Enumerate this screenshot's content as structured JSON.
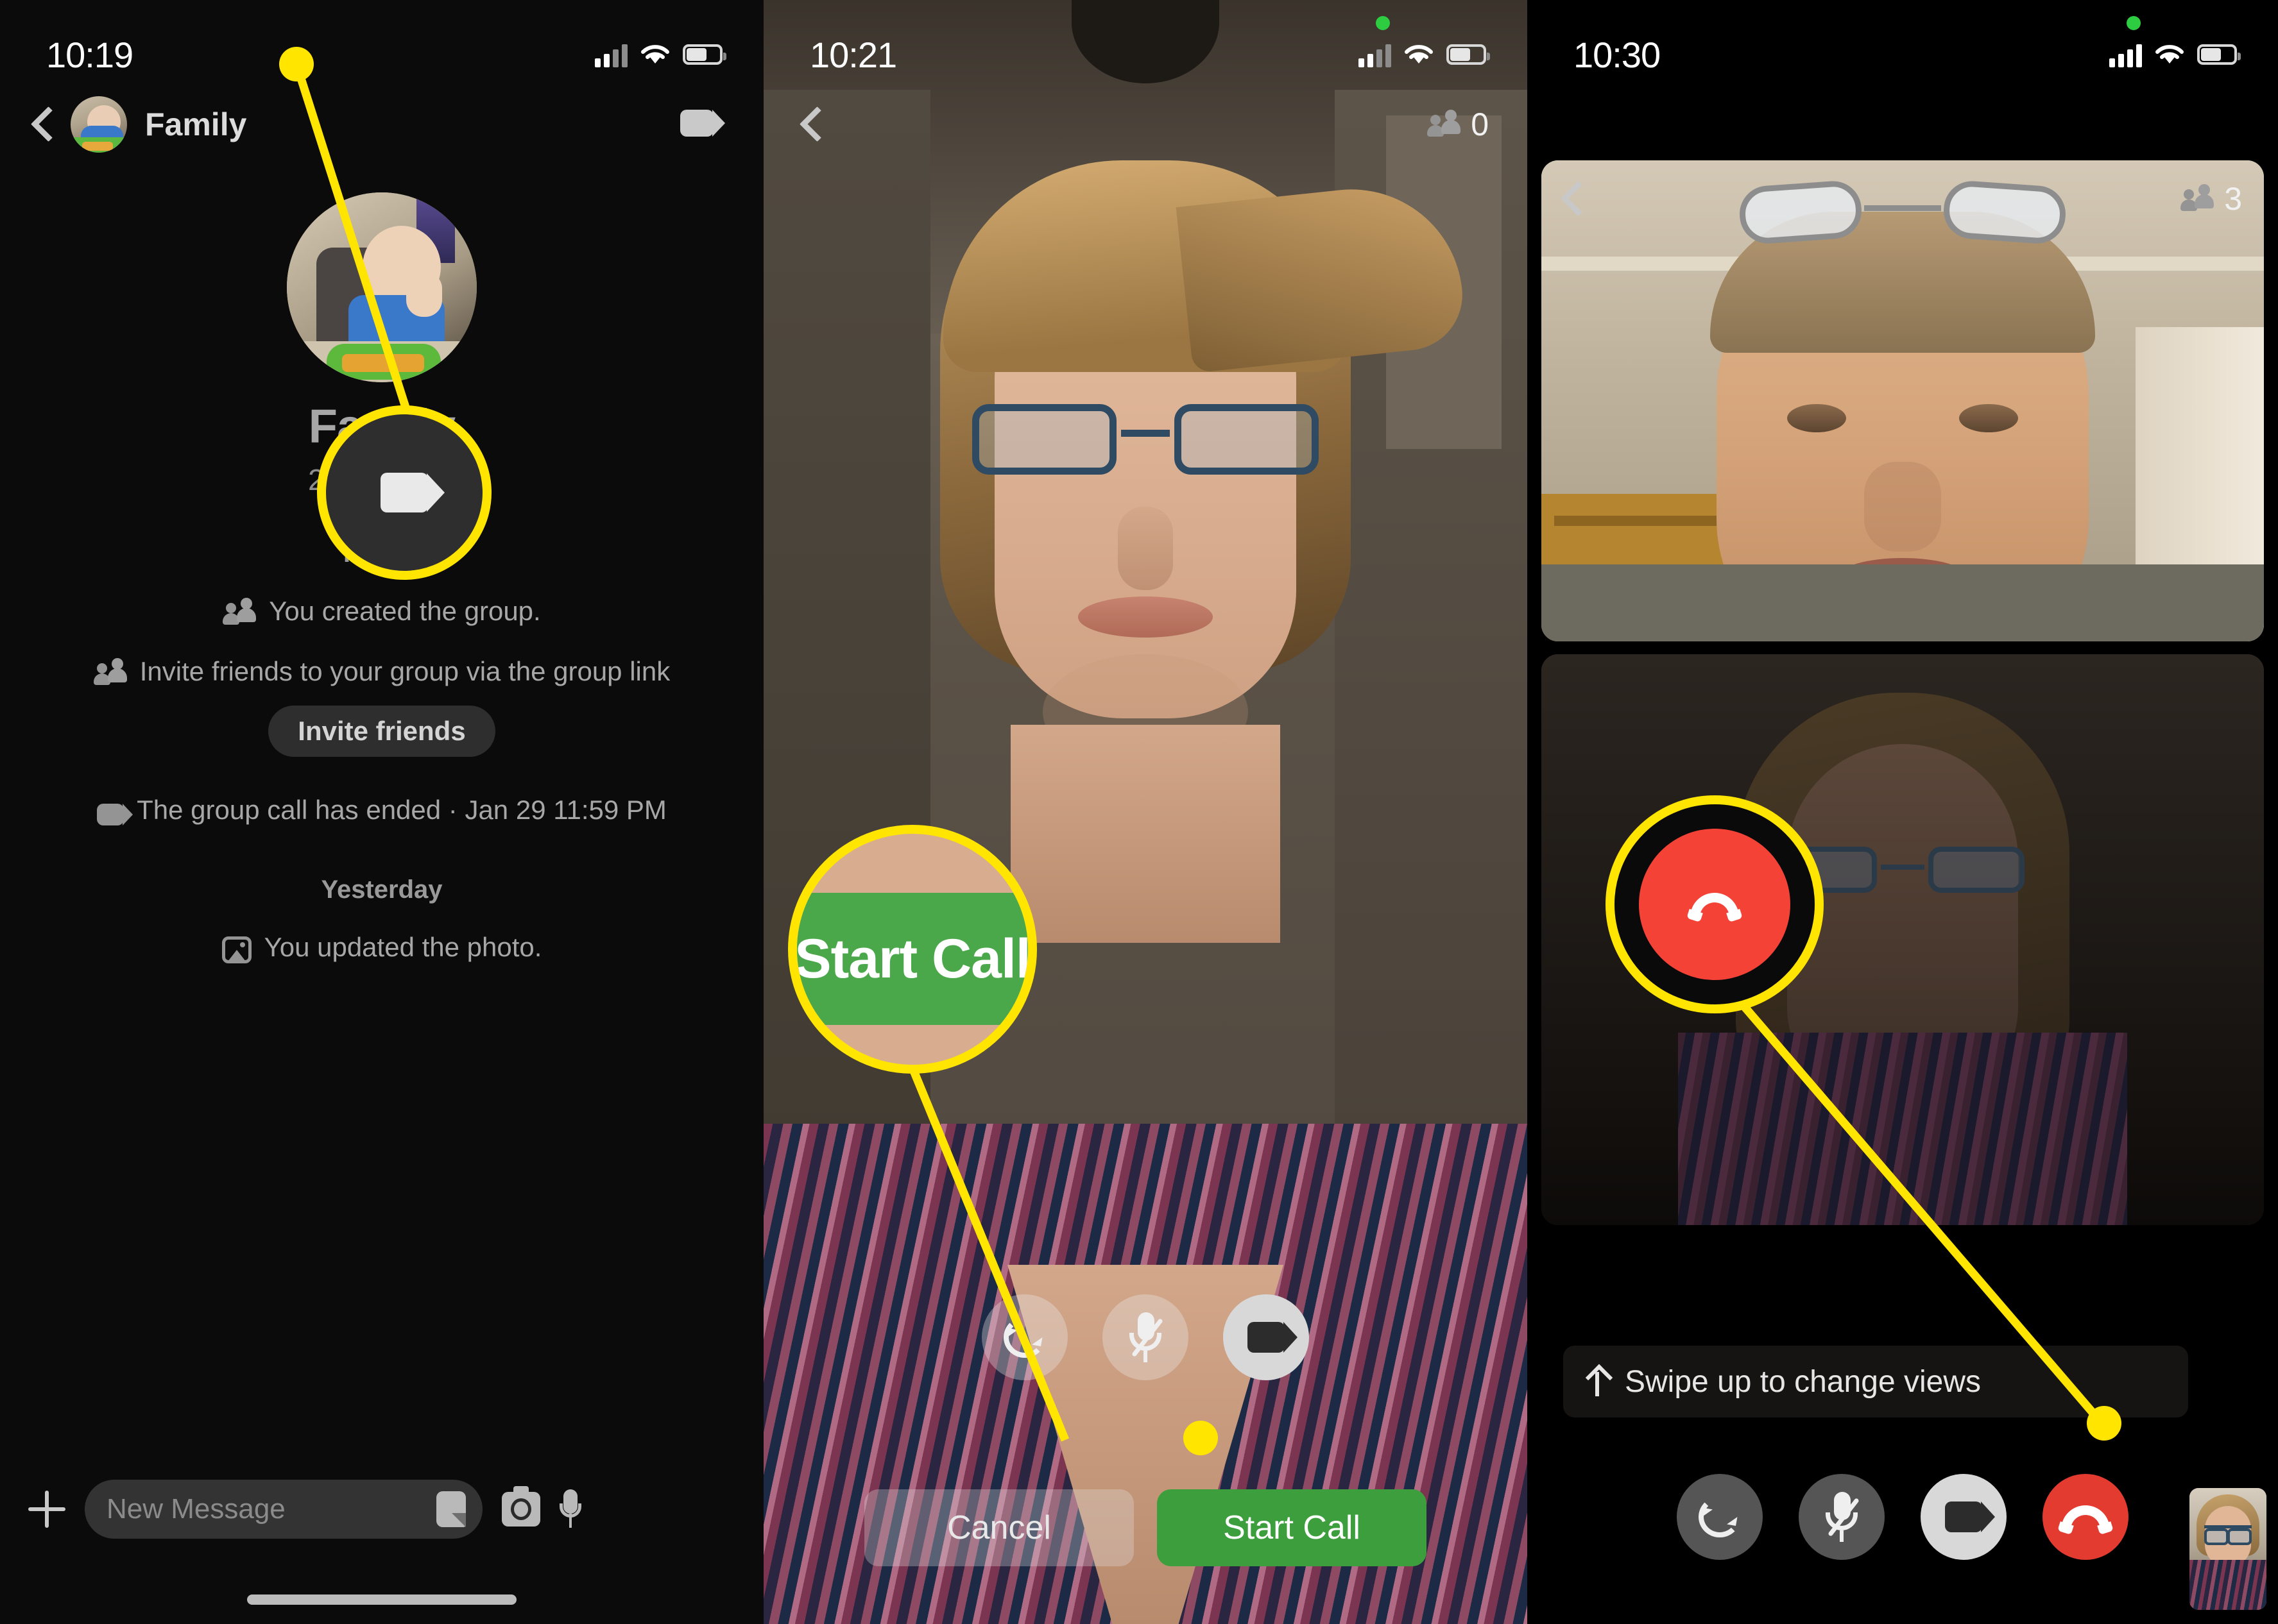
{
  "panels": [
    {
      "id": "chat-detail",
      "status_bar": {
        "time": "10:19",
        "signal": "cellular-bars-icon",
        "wifi": "wifi-icon",
        "battery": "battery-icon"
      },
      "header": {
        "back": "back-chevron-icon",
        "avatar": "group-avatar",
        "title": "Family",
        "video_button": "video-camera-icon"
      },
      "hero": {
        "name": "Family",
        "members": "2 members"
      },
      "day_labels": [
        "Friday",
        "Yesterday"
      ],
      "messages": [
        {
          "icon": "people-icon",
          "text": "You created the group."
        },
        {
          "icon": "people-icon",
          "text": "Invite friends to your group via the group link",
          "action": "Invite friends"
        },
        {
          "icon": "video-camera-icon",
          "text": "The group call has ended · Jan 29 11:59 PM"
        },
        {
          "icon": "photo-icon",
          "text": "You updated the photo."
        }
      ],
      "composer": {
        "add": "plus-icon",
        "placeholder": "New Message",
        "value": "",
        "sticker": "sticker-icon",
        "camera": "camera-icon",
        "mic": "microphone-icon"
      }
    },
    {
      "id": "call-preview",
      "status_bar": {
        "time": "10:21",
        "recording_dot": "green-recording-dot",
        "signal": "cellular-bars-icon",
        "wifi": "wifi-icon",
        "battery": "battery-icon"
      },
      "header": {
        "back": "back-chevron-icon",
        "participants_icon": "people-icon",
        "participants_count": "0"
      },
      "controls": [
        {
          "name": "flip-camera-button",
          "icon": "flip-camera-icon"
        },
        {
          "name": "mute-button",
          "icon": "microphone-off-icon"
        },
        {
          "name": "video-toggle-button",
          "icon": "video-camera-icon"
        }
      ],
      "actions": {
        "cancel": "Cancel",
        "start": "Start Call"
      }
    },
    {
      "id": "in-call",
      "status_bar": {
        "time": "10:30",
        "recording_dot": "green-recording-dot",
        "signal": "cellular-bars-icon",
        "wifi": "wifi-icon",
        "battery": "battery-icon"
      },
      "header": {
        "back": "back-chevron-icon",
        "participants_icon": "people-icon",
        "participants_count": "3"
      },
      "banner": {
        "arrow": "up-arrow-icon",
        "text": "Swipe up to change views"
      },
      "controls": [
        {
          "name": "flip-camera-button",
          "icon": "flip-camera-icon"
        },
        {
          "name": "mute-button",
          "icon": "microphone-off-icon"
        },
        {
          "name": "video-toggle-button",
          "icon": "video-camera-icon"
        },
        {
          "name": "end-call-button",
          "icon": "hangup-icon"
        }
      ]
    }
  ],
  "callouts": [
    {
      "name": "video-call-button-callout",
      "magnified": "video-camera-icon"
    },
    {
      "name": "start-call-button-callout",
      "magnified_label": "Start Call"
    },
    {
      "name": "end-call-button-callout",
      "magnified": "hangup-icon"
    }
  ],
  "colors": {
    "highlight": "#ffe500",
    "start_call_green": "#3d9e3d",
    "end_call_red": "#e33b30",
    "panel_background": "#000000"
  }
}
